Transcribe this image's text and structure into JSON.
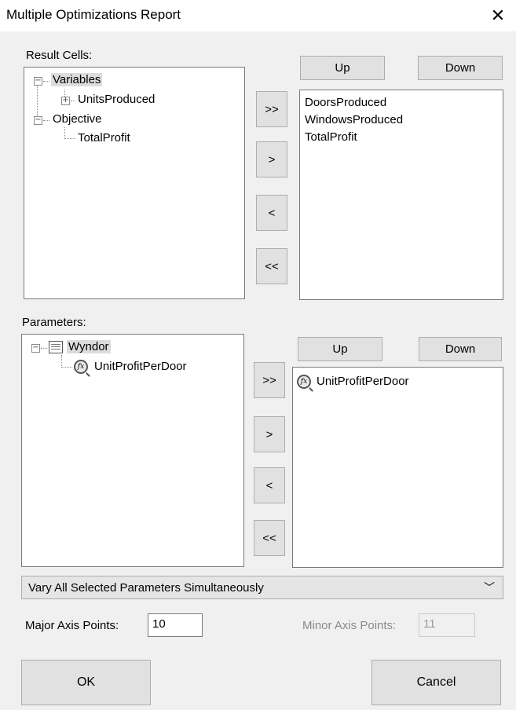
{
  "window": {
    "title": "Multiple Optimizations Report",
    "close": "✕"
  },
  "result_cells": {
    "label": "Result Cells:",
    "tree": {
      "variables": "Variables",
      "units_produced": "UnitsProduced",
      "objective": "Objective",
      "total_profit": "TotalProfit"
    },
    "up": "Up",
    "down": "Down",
    "move_all_right": ">>",
    "move_right": ">",
    "move_left": "<",
    "move_all_left": "<<",
    "selected": [
      "DoorsProduced",
      "WindowsProduced",
      "TotalProfit"
    ]
  },
  "parameters": {
    "label": "Parameters:",
    "tree": {
      "model": "Wyndor",
      "param": "UnitProfitPerDoor"
    },
    "up": "Up",
    "down": "Down",
    "move_all_right": ">>",
    "move_right": ">",
    "move_left": "<",
    "move_all_left": "<<",
    "selected": [
      "UnitProfitPerDoor"
    ]
  },
  "vary_mode": {
    "value": "Vary All Selected Parameters Simultaneously"
  },
  "major_axis": {
    "label": "Major Axis Points:",
    "value": "10"
  },
  "minor_axis": {
    "label": "Minor Axis Points:",
    "value": "11"
  },
  "buttons": {
    "ok": "OK",
    "cancel": "Cancel"
  }
}
